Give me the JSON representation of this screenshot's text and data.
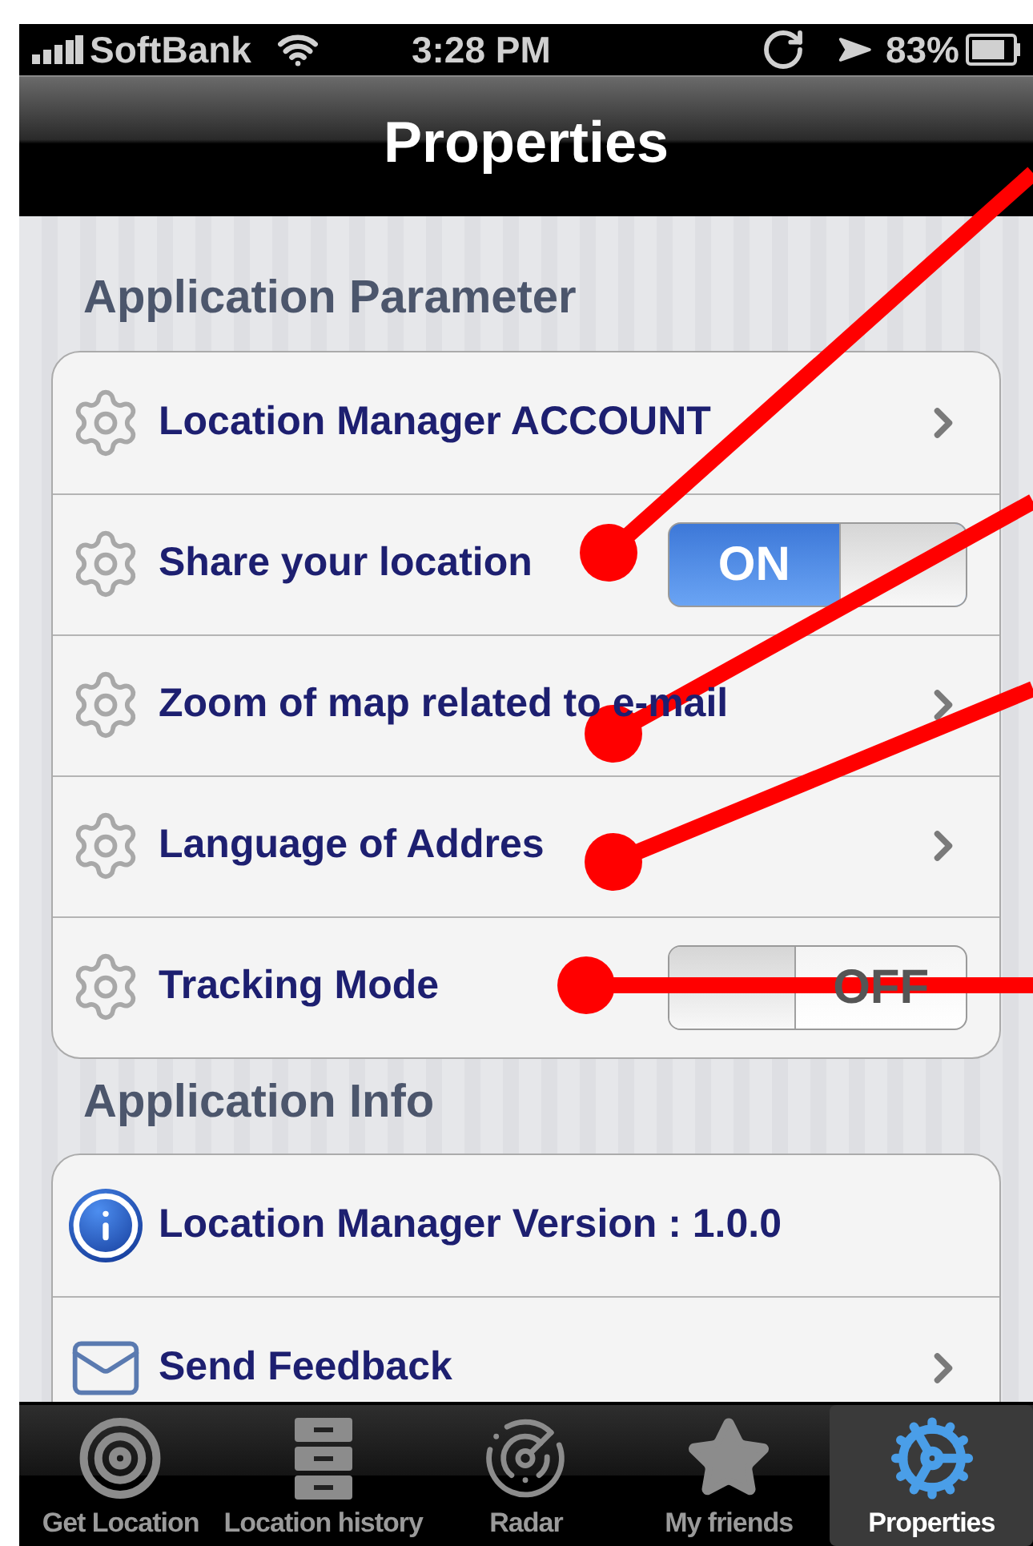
{
  "status_bar": {
    "carrier": "SoftBank",
    "time": "3:28 PM",
    "battery": "83%"
  },
  "nav_bar": {
    "title": "Properties"
  },
  "sections": [
    {
      "header": "Application Parameter",
      "rows": [
        {
          "kind": "setting",
          "label": "Location Manager ACCOUNT"
        },
        {
          "kind": "toggle",
          "label": "Share your location",
          "on": true,
          "switch_label": "ON"
        },
        {
          "kind": "setting",
          "label": "Zoom of map related to e-mail"
        },
        {
          "kind": "setting",
          "label": "Language of Addres"
        },
        {
          "kind": "toggle",
          "label": "Tracking Mode",
          "on": false,
          "switch_label": "OFF"
        }
      ]
    },
    {
      "header": "Application Info",
      "rows": [
        {
          "kind": "info",
          "label": "Location Manager Version : 1.0.0"
        },
        {
          "kind": "feedback",
          "label": "Send Feedback"
        }
      ]
    }
  ],
  "tab_bar": [
    {
      "kind": "target",
      "label": "Get Location",
      "selected": false
    },
    {
      "kind": "cabinet",
      "label": "Location history",
      "selected": false
    },
    {
      "kind": "radar",
      "label": "Radar",
      "selected": false
    },
    {
      "kind": "star",
      "label": "My friends",
      "selected": false
    },
    {
      "kind": "gears",
      "label": "Properties",
      "selected": true
    }
  ]
}
